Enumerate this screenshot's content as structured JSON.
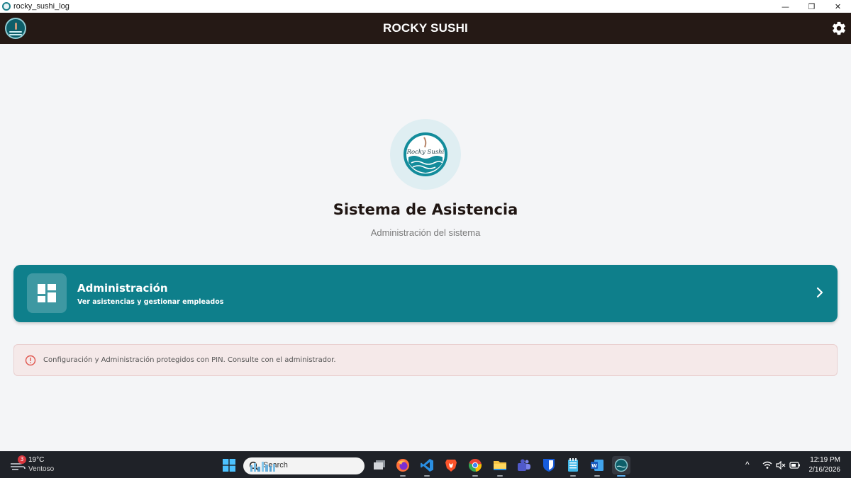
{
  "window": {
    "title": "rocky_sushi_log",
    "minimize_glyph": "—",
    "restore_glyph": "❐",
    "close_glyph": "✕"
  },
  "header": {
    "title": "ROCKY SUSHI",
    "settings_icon": "gear-icon"
  },
  "hero": {
    "logo_text": "Rocky Sushi",
    "title": "Sistema de Asistencia",
    "subtitle": "Administración del sistema"
  },
  "admin_card": {
    "title": "Administración",
    "subtitle": "Ver asistencias y gestionar empleados",
    "icon": "dashboard-icon",
    "color": "#0e7f8b"
  },
  "alert": {
    "icon": "info-circle-icon",
    "text": "Configuración y Administración protegidos con PIN. Consulte con el administrador.",
    "color": "#e0554d"
  },
  "taskbar": {
    "weather": {
      "badge": "3",
      "temp": "19°C",
      "condition": "Ventoso"
    },
    "search_placeholder": "Search",
    "apps": [
      "windows-start",
      "task-view",
      "firefox",
      "vscode",
      "brave",
      "chrome",
      "file-explorer",
      "teams",
      "bitwarden",
      "notepad",
      "word",
      "rocky-sushi-log"
    ],
    "tray": {
      "chevron": "^",
      "time": "12:19 PM",
      "date": "2/16/2026"
    }
  },
  "colors": {
    "appbar": "#251915",
    "background": "#f4f5f7",
    "accent": "#0e7f8b"
  }
}
